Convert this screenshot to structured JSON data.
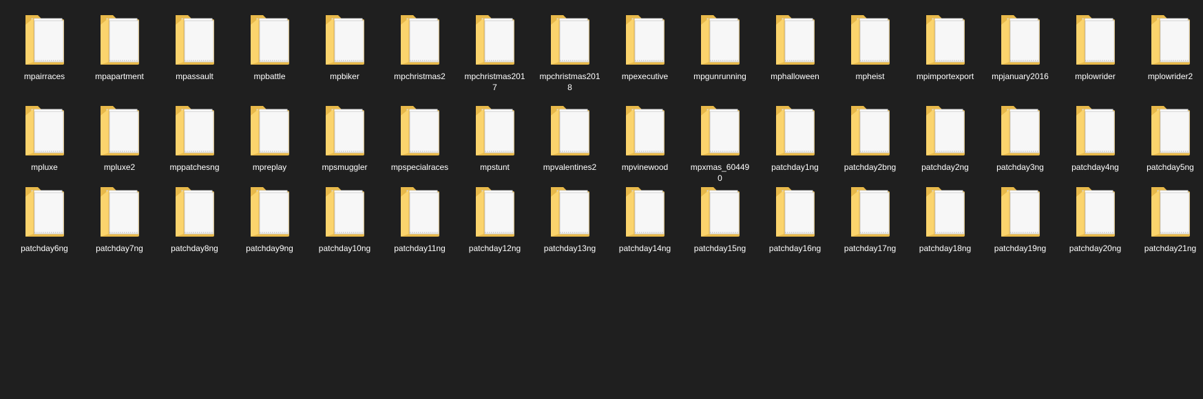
{
  "folders": [
    "mpairraces",
    "mpapartment",
    "mpassault",
    "mpbattle",
    "mpbiker",
    "mpchristmas2",
    "mpchristmas2017",
    "mpchristmas2018",
    "mpexecutive",
    "mpgunrunning",
    "mphalloween",
    "mpheist",
    "mpimportexport",
    "mpjanuary2016",
    "mplowrider",
    "mplowrider2",
    "mpluxe",
    "mpluxe2",
    "mppatchesng",
    "mpreplay",
    "mpsmuggler",
    "mpspecialraces",
    "mpstunt",
    "mpvalentines2",
    "mpvinewood",
    "mpxmas_604490",
    "patchday1ng",
    "patchday2bng",
    "patchday2ng",
    "patchday3ng",
    "patchday4ng",
    "patchday5ng",
    "patchday6ng",
    "patchday7ng",
    "patchday8ng",
    "patchday9ng",
    "patchday10ng",
    "patchday11ng",
    "patchday12ng",
    "patchday13ng",
    "patchday14ng",
    "patchday15ng",
    "patchday16ng",
    "patchday17ng",
    "patchday18ng",
    "patchday19ng",
    "patchday20ng",
    "patchday21ng"
  ],
  "icon": "folder-icon",
  "colors": {
    "background": "#1f1f1f",
    "folder_back": "#e8b94a",
    "folder_front": "#fbd46d",
    "paper": "#f7f7f7",
    "label": "#ffffff"
  }
}
